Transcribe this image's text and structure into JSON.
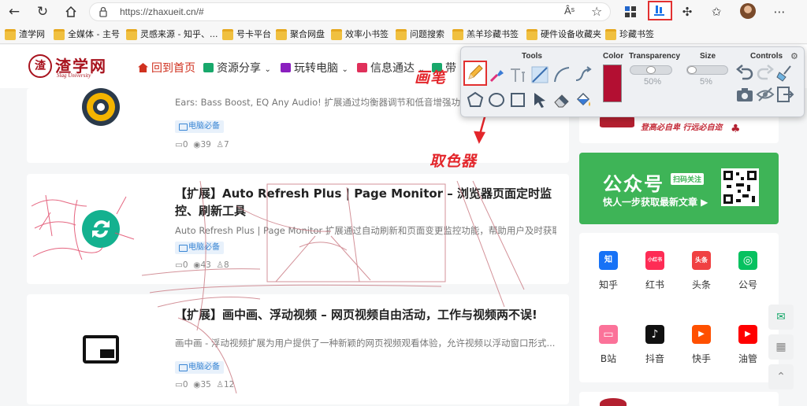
{
  "browser": {
    "url": "https://zhaxueit.cn/#",
    "read_aloud": "Âˢ",
    "bookmarks": [
      "渣学网",
      "全媒体 - 主号",
      "灵感来源 - 知乎、...",
      "号卡平台",
      "聚合网盘",
      "效率小书签",
      "问题搜索",
      "羔羊珍藏书签",
      "硬件设备收藏夹",
      "珍藏书签"
    ]
  },
  "site": {
    "logo_text": "渣学网",
    "logo_seal": "渣",
    "logo_sub": "Slag University",
    "menu": [
      "回到首页",
      "资源分享",
      "玩转电脑",
      "信息通达",
      "带"
    ]
  },
  "articles": [
    {
      "title": "",
      "desc": "Ears: Bass Boost, EQ Any Audio! 扩展通过均衡器调节和低音增强功能,",
      "tag": "电脑必备",
      "comments": "0",
      "views": "39",
      "likes": "7"
    },
    {
      "title": "【扩展】Auto Refresh Plus | Page Monitor – 浏览器页面定时监控、刷新工具",
      "desc": "Auto Refresh Plus | Page Monitor 扩展通过自动刷新和页面变更监控功能，帮助用户及时获取...",
      "tag": "电脑必备",
      "comments": "0",
      "views": "43",
      "likes": "8"
    },
    {
      "title": "【扩展】画中画、浮动视频 – 网页视频自由活动，工作与视频两不误!",
      "desc": "画中画 - 浮动视频扩展为用户提供了一种新颖的网页视频观看体验，允许视频以浮动窗口形式...",
      "tag": "电脑必备",
      "comments": "0",
      "views": "35",
      "likes": "12"
    }
  ],
  "sidebar": {
    "slogan": "登高必自卑 行远必自迩",
    "gzh_title": "公众号",
    "gzh_badge": "扫码关注",
    "gzh_sub": "快人一步获取最新文章 ▶",
    "socials": [
      {
        "label": "知乎",
        "icon": "知",
        "color": "#1772f6"
      },
      {
        "label": "红书",
        "icon": "小红书",
        "color": "#fe2c55"
      },
      {
        "label": "头条",
        "icon": "头条",
        "color": "#f04142"
      },
      {
        "label": "公号",
        "icon": "◎",
        "color": "#07c160"
      },
      {
        "label": "B站",
        "icon": "▭",
        "color": "#fb7299"
      },
      {
        "label": "抖音",
        "icon": "♪",
        "color": "#111111"
      },
      {
        "label": "快手",
        "icon": "▶",
        "color": "#ff5000"
      },
      {
        "label": "油管",
        "icon": "▶",
        "color": "#ff0000"
      }
    ]
  },
  "annotation_toolbar": {
    "headers": {
      "tools": "Tools",
      "color": "Color",
      "transparency": "Transparency",
      "size": "Size",
      "controls": "Controls"
    },
    "transparency_value": "50%",
    "size_value": "5%",
    "current_color": "#b30f32"
  },
  "annotations": {
    "pen_label": "画笔",
    "picker_label": "取色器"
  }
}
